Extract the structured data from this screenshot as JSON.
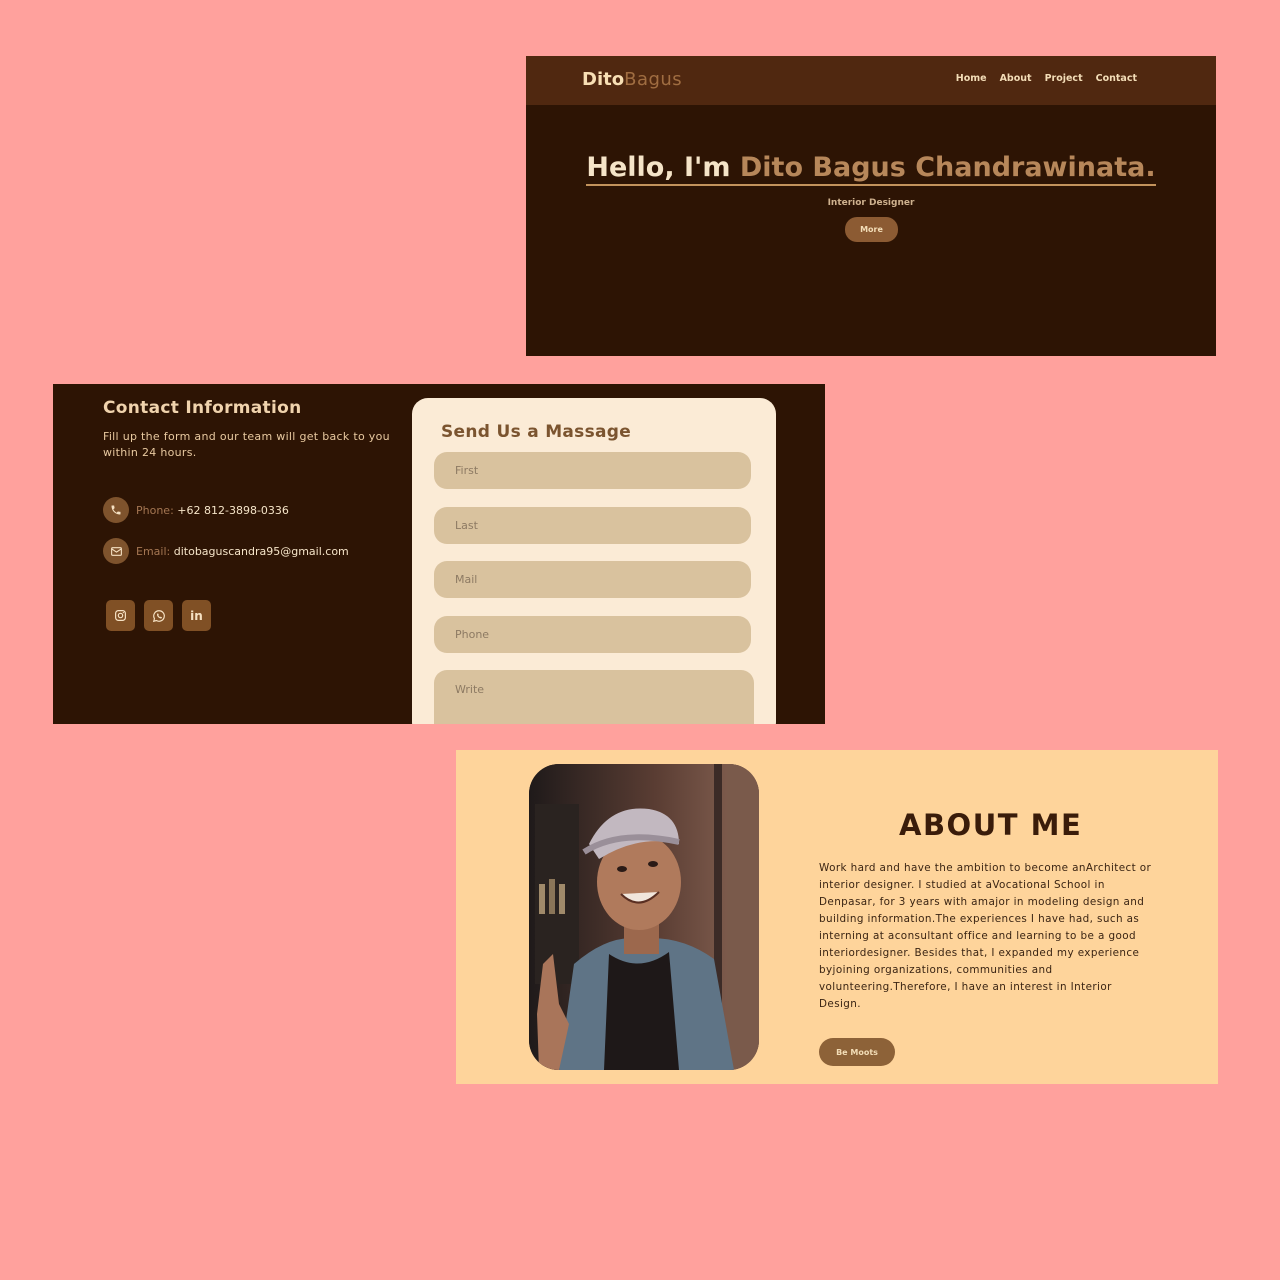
{
  "hero": {
    "logo_part1": "Dito",
    "logo_part2": "Bagus",
    "nav": [
      "Home",
      "About",
      "Project",
      "Contact"
    ],
    "greeting": "Hello, I'm ",
    "name": "Dito Bagus Chandrawinata.",
    "subtitle": "Interior Designer",
    "button": "More"
  },
  "contact": {
    "title": "Contact Information",
    "description": "Fill up the form and our team will get back to you within 24 hours.",
    "phone_label": "Phone: ",
    "phone_value": "+62 812-3898-0336",
    "email_label": "Email: ",
    "email_value": "ditobaguscandra95@gmail.com",
    "socials": [
      "instagram-icon",
      "whatsapp-icon",
      "linkedin-icon"
    ]
  },
  "form": {
    "title": "Send Us a Massage",
    "first_placeholder": "First",
    "last_placeholder": "Last",
    "mail_placeholder": "Mail",
    "phone_placeholder": "Phone",
    "write_placeholder": "Write"
  },
  "about": {
    "title": "ABOUT ME",
    "text": "Work hard and have the ambition to become anArchitect or interior designer. I studied at aVocational School in Denpasar, for 3 years with amajor in modeling design and building information.The experiences I have had, such as interning at aconsultant office and learning to be a good interiordesigner. Besides that, I expanded my experience byjoining organizations, communities and volunteering.Therefore, I have an interest in Interior Design.",
    "button": "Be Moots"
  },
  "colors": {
    "background": "#ffa19d",
    "dark_brown": "#2d1404",
    "nav_brown": "#502810",
    "accent": "#b7875a",
    "cream": "#fbebd6",
    "about_bg": "#fed49b"
  }
}
